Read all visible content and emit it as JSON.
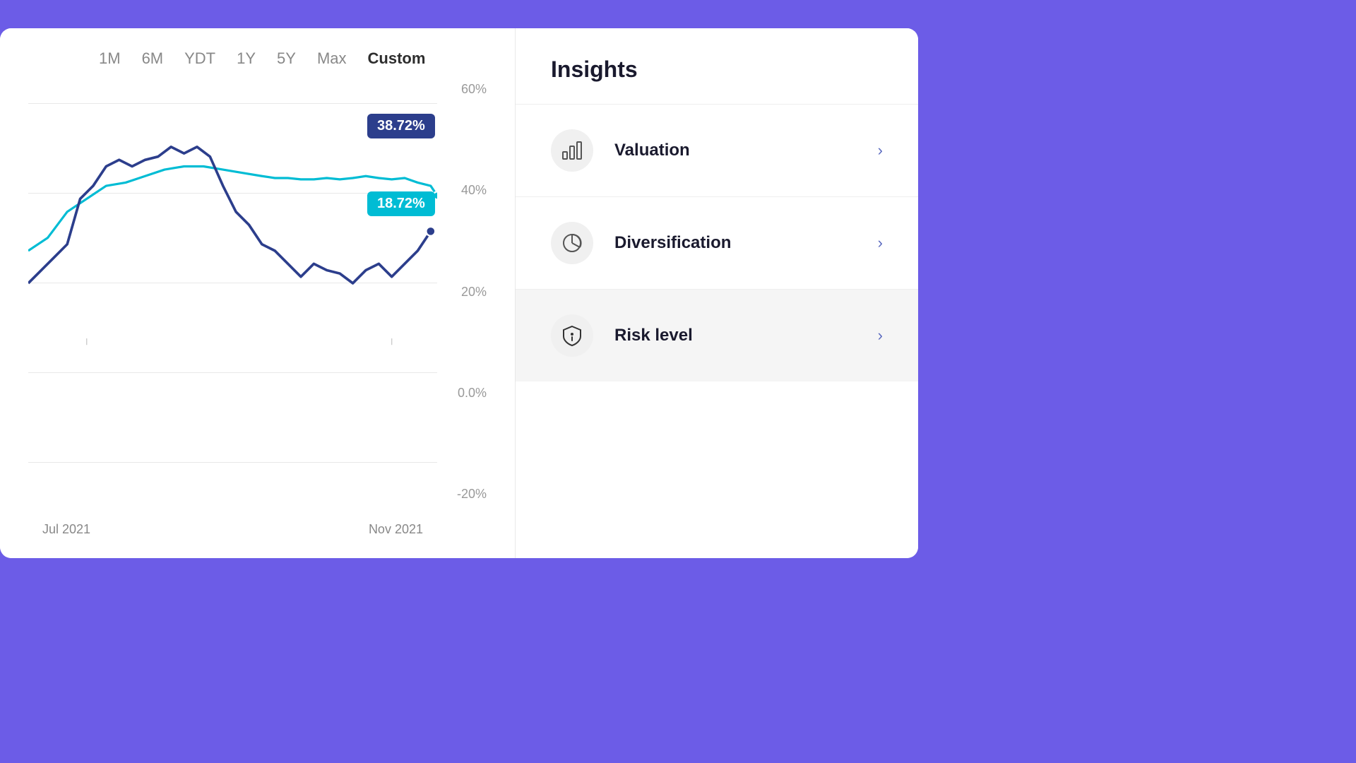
{
  "header": {
    "background_color": "#6c5ce7"
  },
  "chart": {
    "time_filters": [
      {
        "label": "1M",
        "active": false
      },
      {
        "label": "6M",
        "active": false
      },
      {
        "label": "YDT",
        "active": false
      },
      {
        "label": "1Y",
        "active": false
      },
      {
        "label": "5Y",
        "active": false
      },
      {
        "label": "Max",
        "active": false
      },
      {
        "label": "Custom",
        "active": true
      }
    ],
    "y_axis": [
      "60%",
      "40%",
      "20%",
      "0.0%",
      "-20%"
    ],
    "x_axis": [
      "Jul 2021",
      "Nov 2021"
    ],
    "tooltip_blue": "38.72%",
    "tooltip_cyan": "18.72%"
  },
  "insights": {
    "title": "Insights",
    "items": [
      {
        "label": "Valuation",
        "icon": "bar-chart-icon"
      },
      {
        "label": "Diversification",
        "icon": "pie-chart-icon"
      },
      {
        "label": "Risk level",
        "icon": "shield-icon",
        "active": true
      }
    ]
  }
}
